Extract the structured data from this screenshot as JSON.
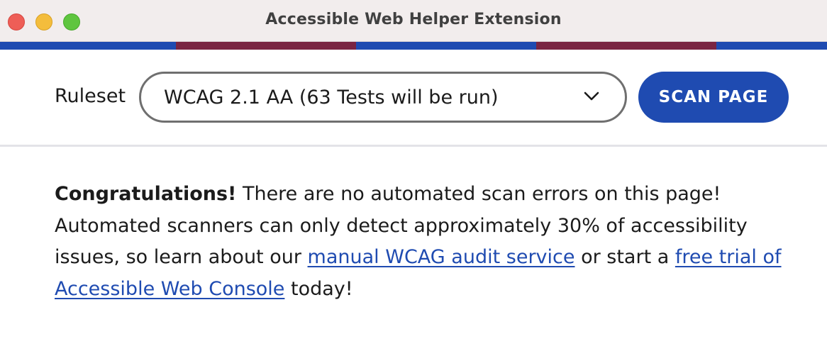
{
  "window": {
    "title": "Accessible Web Helper Extension"
  },
  "stripe_colors": [
    "#1f4bb1",
    "#7a2542",
    "#1f4bb1",
    "#7a2542",
    "#1f4bb1"
  ],
  "toolbar": {
    "ruleset_label": "Ruleset",
    "ruleset_selected": "WCAG 2.1 AA (63 Tests will be run)",
    "scan_button_label": "SCAN PAGE"
  },
  "message": {
    "lead_bold": "Congratulations!",
    "text_1": " There are no automated scan errors on this page! Automated scanners can only detect approximately 30% of accessibility issues, so learn about our ",
    "link_audit": "manual WCAG audit service",
    "text_2": " or start a ",
    "link_trial": "free trial of Accessible Web Console",
    "text_3": " today!"
  },
  "colors": {
    "accent": "#1f4bb1",
    "secondary": "#7a2542",
    "text": "#1b1b1b"
  },
  "icons": {
    "dropdown": "chevron-down-icon"
  }
}
